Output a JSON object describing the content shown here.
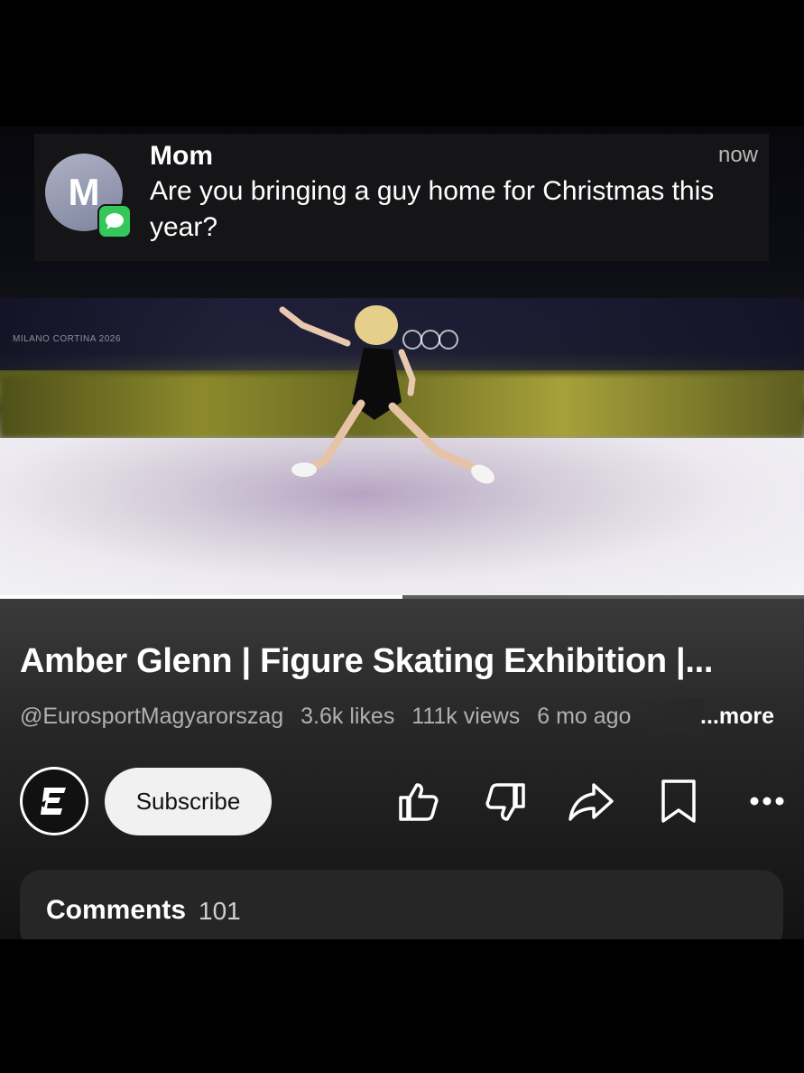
{
  "notification": {
    "sender": "Mom",
    "avatar_letter": "M",
    "time": "now",
    "message": "Are you bringing a guy home for Christmas this year?",
    "app_badge_icon": "messages-icon"
  },
  "video": {
    "watermark_text": "MILANO CORTINA 2026",
    "progress": 0.5
  },
  "info": {
    "title": "Amber Glenn | Figure Skating Exhibition |...",
    "channel": "@EurosportMagyarorszag",
    "likes": "3.6k likes",
    "views": "111k views",
    "age": "6 mo ago",
    "more_label": "...more"
  },
  "actions": {
    "subscribe_label": "Subscribe",
    "icons": [
      "thumbs-up-icon",
      "thumbs-down-icon",
      "share-icon",
      "save-icon",
      "more-icon"
    ]
  },
  "comments": {
    "label": "Comments",
    "count": "101"
  }
}
